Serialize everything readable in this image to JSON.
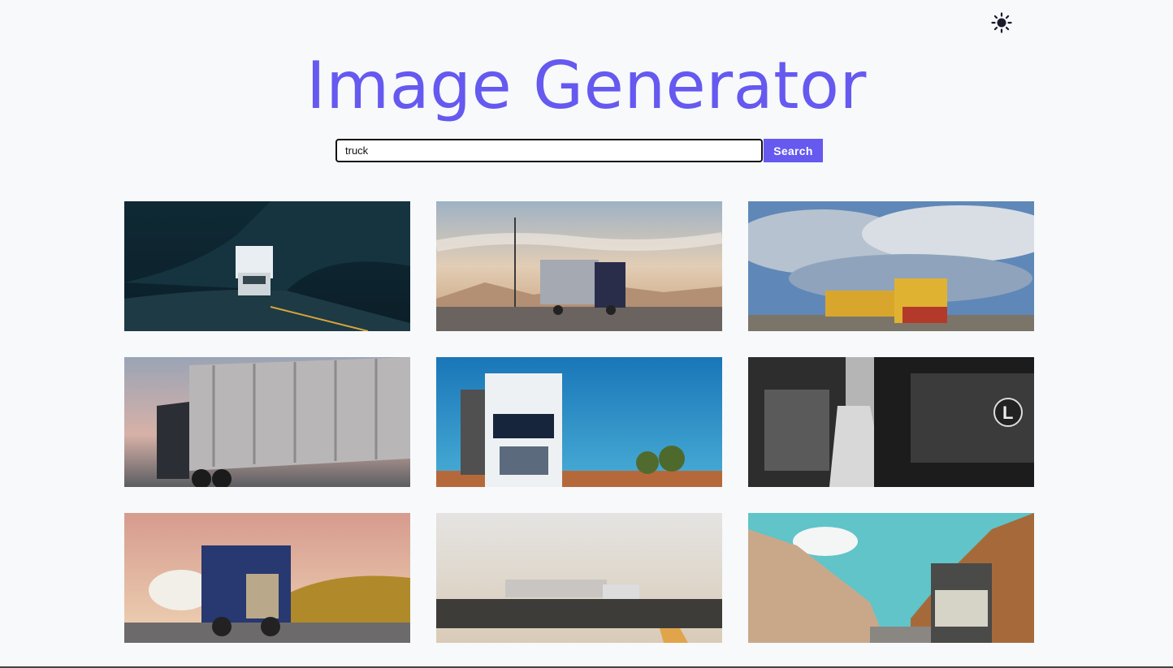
{
  "header": {
    "title": "Image Generator",
    "theme_toggle_icon": "sun-icon"
  },
  "search": {
    "value": "truck",
    "button_label": "Search"
  },
  "results": {
    "images": [
      {
        "icon": "truck-image",
        "description_visible": false
      },
      {
        "icon": "truck-image",
        "description_visible": false
      },
      {
        "icon": "truck-image",
        "description_visible": false
      },
      {
        "icon": "truck-image",
        "description_visible": false
      },
      {
        "icon": "truck-image",
        "description_visible": false
      },
      {
        "icon": "truck-image",
        "description_visible": false
      },
      {
        "icon": "truck-image",
        "description_visible": false
      },
      {
        "icon": "truck-image",
        "description_visible": false
      },
      {
        "icon": "truck-image",
        "description_visible": false
      }
    ]
  },
  "colors": {
    "accent": "#6559f0",
    "background": "#f7f9fb"
  }
}
